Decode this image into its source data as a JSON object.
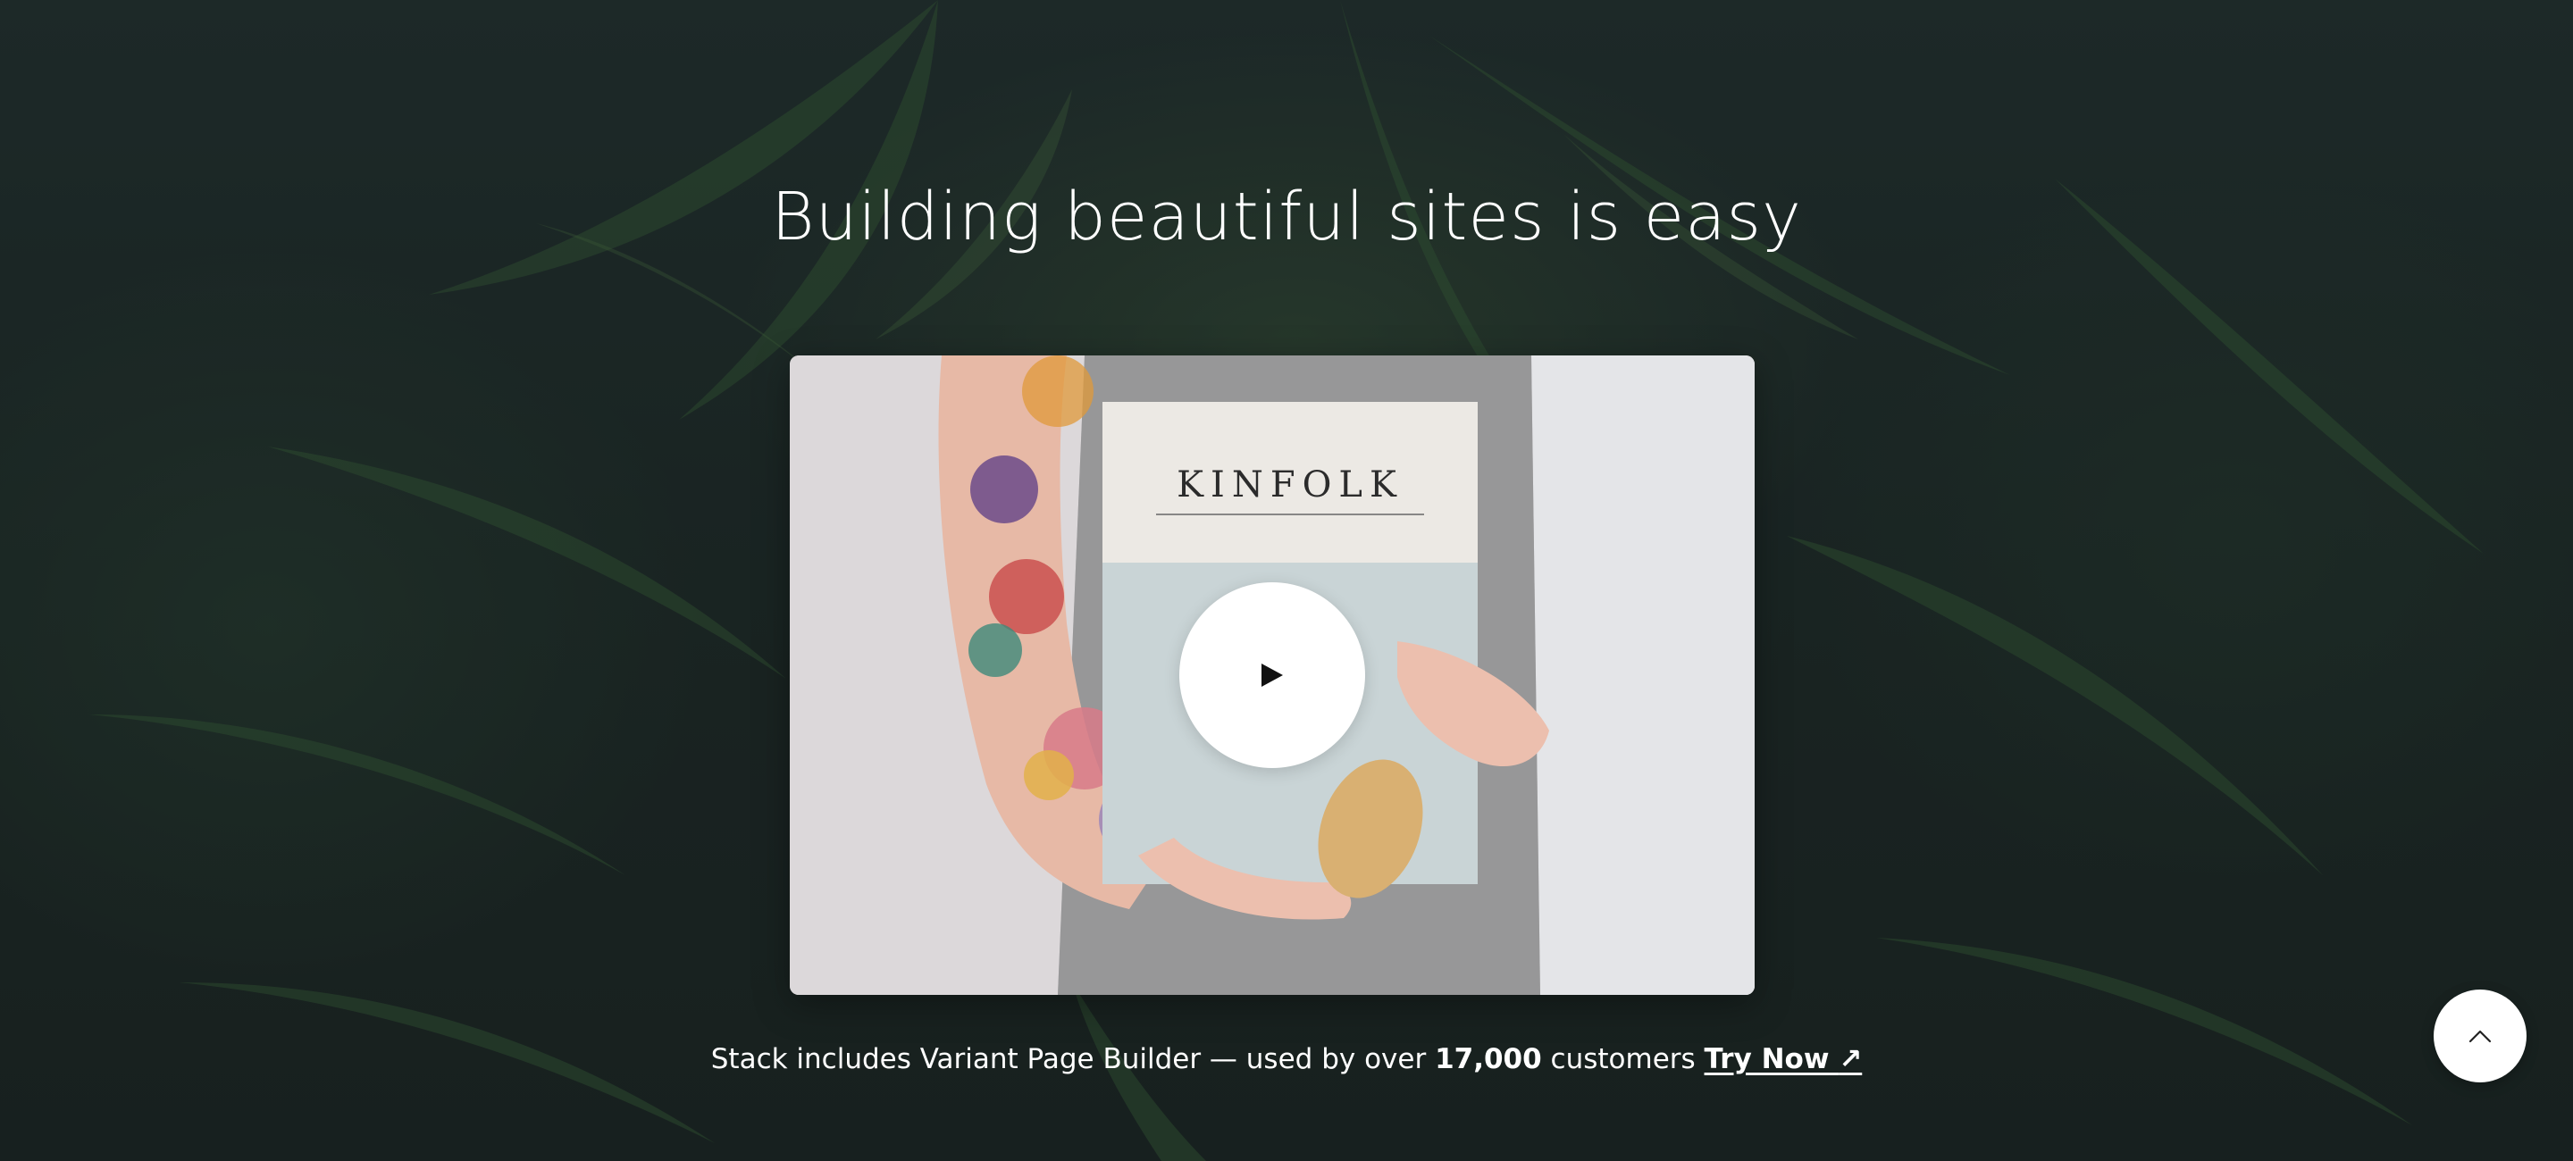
{
  "hero": {
    "headline": "Building beautiful sites is easy"
  },
  "video": {
    "magazine_title": "KINFOLK",
    "play_icon": "play-icon"
  },
  "tagline": {
    "prefix": "Stack includes Variant Page Builder — used by over ",
    "count": "17,000",
    "suffix": " customers ",
    "link_label": "Try Now",
    "link_icon": "arrow-up-right-icon",
    "link_glyph": "↗"
  },
  "scroll_top": {
    "icon": "chevron-up-icon"
  },
  "colors": {
    "background": "#1f2827",
    "text": "#ffffff",
    "card_bg": "#e6e6e8",
    "button_bg": "#ffffff"
  }
}
